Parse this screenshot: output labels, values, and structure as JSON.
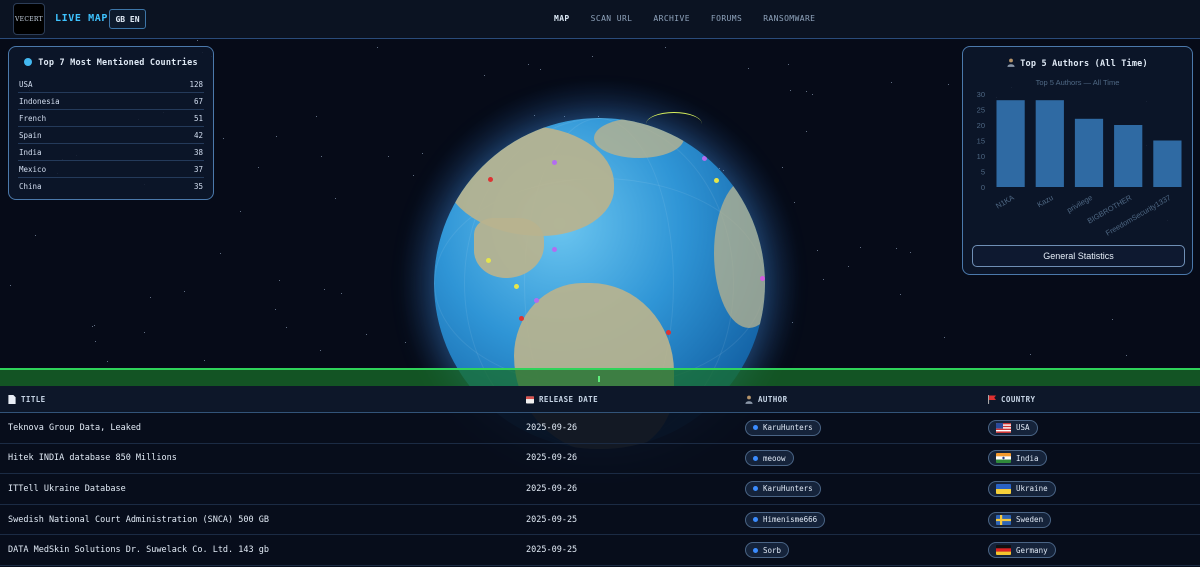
{
  "app": {
    "logo_text": "VECERT",
    "brand": "LIVE MAP",
    "language": "GB EN"
  },
  "nav": {
    "items": [
      {
        "label": "MAP",
        "active": true
      },
      {
        "label": "SCAN URL",
        "active": false
      },
      {
        "label": "ARCHIVE",
        "active": false
      },
      {
        "label": "FORUMS",
        "active": false
      },
      {
        "label": "RANSOMWARE",
        "active": false
      }
    ]
  },
  "countries_panel": {
    "title": "Top 7 Most Mentioned Countries",
    "rows": [
      {
        "name": "USA",
        "count": "128"
      },
      {
        "name": "Indonesia",
        "count": "67"
      },
      {
        "name": "French",
        "count": "51"
      },
      {
        "name": "Spain",
        "count": "42"
      },
      {
        "name": "India",
        "count": "38"
      },
      {
        "name": "Mexico",
        "count": "37"
      },
      {
        "name": "China",
        "count": "35"
      }
    ]
  },
  "authors_panel": {
    "title": "Top 5 Authors (All Time)",
    "button": "General Statistics"
  },
  "chart_data": {
    "type": "bar",
    "title": "Top 5 Authors — All Time",
    "categories": [
      "N1KA",
      "Kazu",
      "privilege",
      "BIGBROTHER",
      "FreedomSecurity1337"
    ],
    "values": [
      28,
      28,
      22,
      20,
      15
    ],
    "ylim": [
      0,
      30
    ],
    "yticks": [
      0,
      5,
      10,
      15,
      20,
      25,
      30
    ],
    "grid": false,
    "bar_color": "#2f6aa3"
  },
  "table": {
    "headers": {
      "title": "TITLE",
      "date": "RELEASE DATE",
      "author": "AUTHOR",
      "country": "COUNTRY"
    },
    "rows": [
      {
        "title": "Teknova Group Data, Leaked",
        "date": "2025-09-26",
        "author": "KaruHunters",
        "country": "USA",
        "flag": "us"
      },
      {
        "title": "Hitek INDIA database 850 Millions",
        "date": "2025-09-26",
        "author": "meoow",
        "country": "India",
        "flag": "in"
      },
      {
        "title": "ITTell Ukraine Database",
        "date": "2025-09-26",
        "author": "KaruHunters",
        "country": "Ukraine",
        "flag": "ua"
      },
      {
        "title": "Swedish National Court Administration (SNCA) 500 GB",
        "date": "2025-09-25",
        "author": "Himenisme666",
        "country": "Sweden",
        "flag": "se"
      },
      {
        "title": "DATA MedSkin Solutions Dr. Suwelack Co. Ltd. 143 gb",
        "date": "2025-09-25",
        "author": "Sorb",
        "country": "Germany",
        "flag": "de"
      }
    ]
  }
}
